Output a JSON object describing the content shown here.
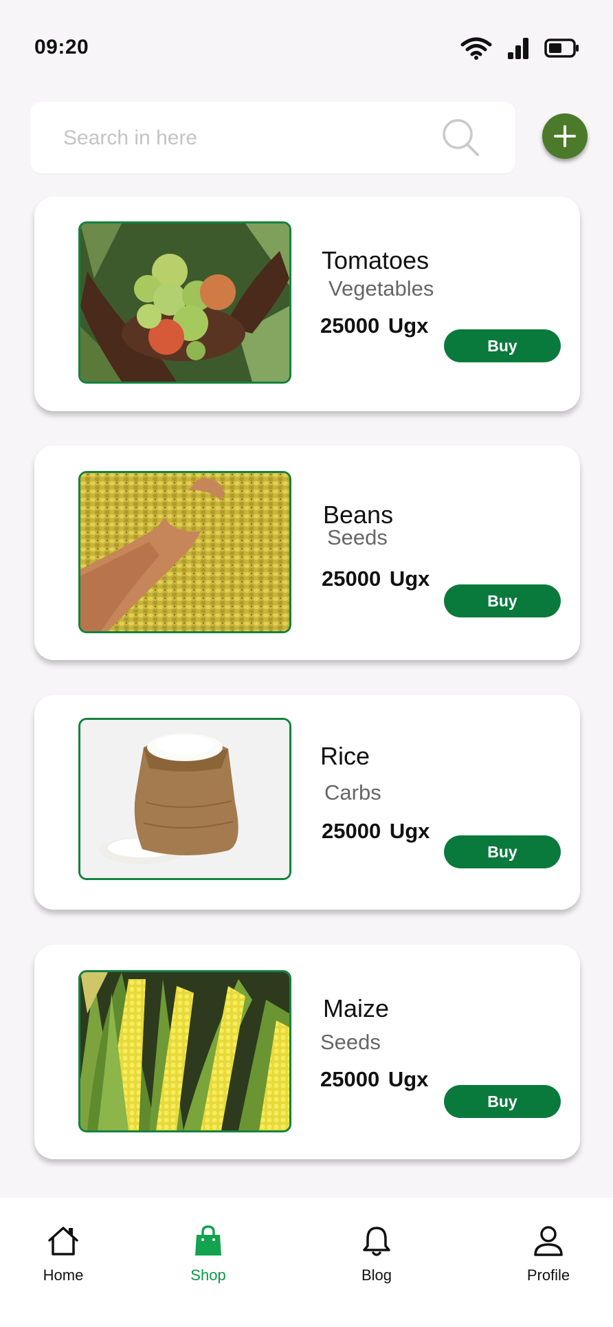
{
  "status_bar": {
    "time": "09:20",
    "icons": [
      "wifi-icon",
      "cellular-signal-icon",
      "battery-icon"
    ]
  },
  "search": {
    "placeholder": "Search in here",
    "value": ""
  },
  "add_button": {
    "icon": "plus-icon",
    "color": "#4b7a2a"
  },
  "products": [
    {
      "name": "Tomatoes",
      "category": "Vegetables",
      "price": "25000 Ugx",
      "buy_label": "Buy"
    },
    {
      "name": "Beans",
      "category": "Seeds",
      "price": "25000 Ugx",
      "buy_label": "Buy"
    },
    {
      "name": "Rice",
      "category": "Carbs",
      "price": "25000 Ugx",
      "buy_label": "Buy"
    },
    {
      "name": "Maize",
      "category": "Seeds",
      "price": "25000 Ugx",
      "buy_label": "Buy"
    }
  ],
  "colors": {
    "accent": "#0a7a3c",
    "image_border": "#14823f",
    "active_nav": "#0a9a48",
    "background": "#f7f5f7"
  },
  "nav": {
    "items": [
      {
        "label": "Home",
        "icon": "home-icon",
        "active": false
      },
      {
        "label": "Shop",
        "icon": "shopping-bag-icon",
        "active": true
      },
      {
        "label": "Blog",
        "icon": "bell-icon",
        "active": false
      },
      {
        "label": "Profile",
        "icon": "user-icon",
        "active": false
      }
    ]
  }
}
